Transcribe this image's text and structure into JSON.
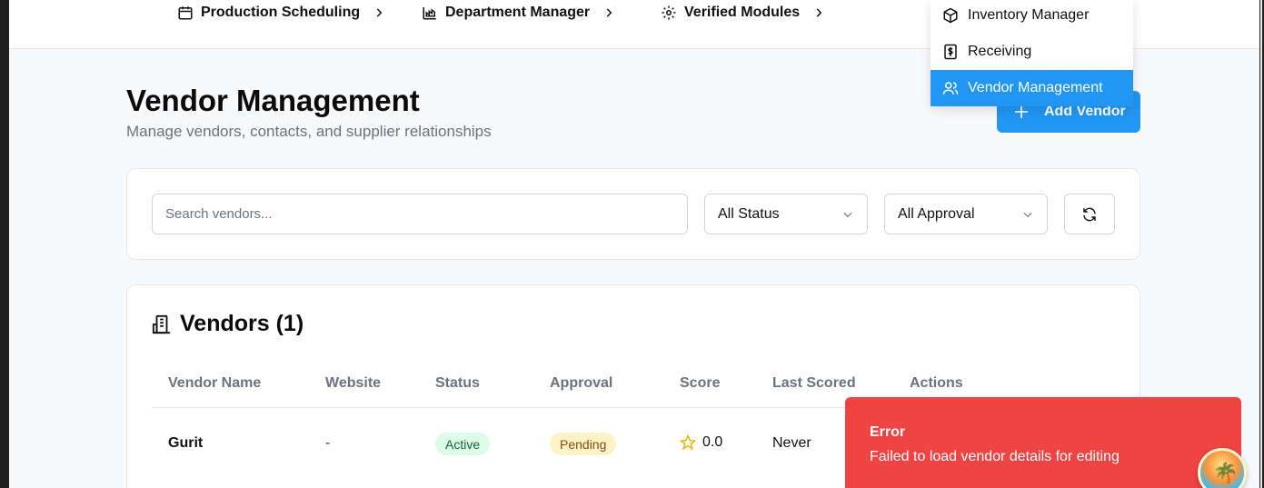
{
  "nav": {
    "items": [
      {
        "label": "Production Scheduling",
        "icon": "calendar-icon"
      },
      {
        "label": "Department Manager",
        "icon": "factory-chart-icon"
      },
      {
        "label": "Verified Modules",
        "icon": "gear-icon"
      }
    ]
  },
  "dropdown": {
    "items": [
      {
        "label": "Inventory Manager",
        "icon": "package-icon"
      },
      {
        "label": "Receiving",
        "icon": "dollar-receipt-icon"
      },
      {
        "label": "Vendor Management",
        "icon": "users-icon",
        "active": true
      }
    ]
  },
  "page": {
    "title": "Vendor Management",
    "subtitle": "Manage vendors, contacts, and supplier relationships",
    "add_button": "Add Vendor"
  },
  "filters": {
    "search_placeholder": "Search vendors...",
    "status": "All Status",
    "approval": "All Approval",
    "refresh_icon": "refresh-icon"
  },
  "vendors": {
    "heading": "Vendors (1)",
    "columns": [
      "Vendor Name",
      "Website",
      "Status",
      "Approval",
      "Score",
      "Last Scored",
      "Actions"
    ],
    "rows": [
      {
        "name": "Gurit",
        "website": "-",
        "status": "Active",
        "approval": "Pending",
        "score": "0.0",
        "last_scored": "Never"
      }
    ]
  },
  "toast": {
    "title": "Error",
    "message": "Failed to load vendor details for editing"
  },
  "colors": {
    "accent": "#2196f3",
    "error": "#ef4444",
    "active_badge": "#dcfce7",
    "pending_badge": "#fef3c7"
  }
}
